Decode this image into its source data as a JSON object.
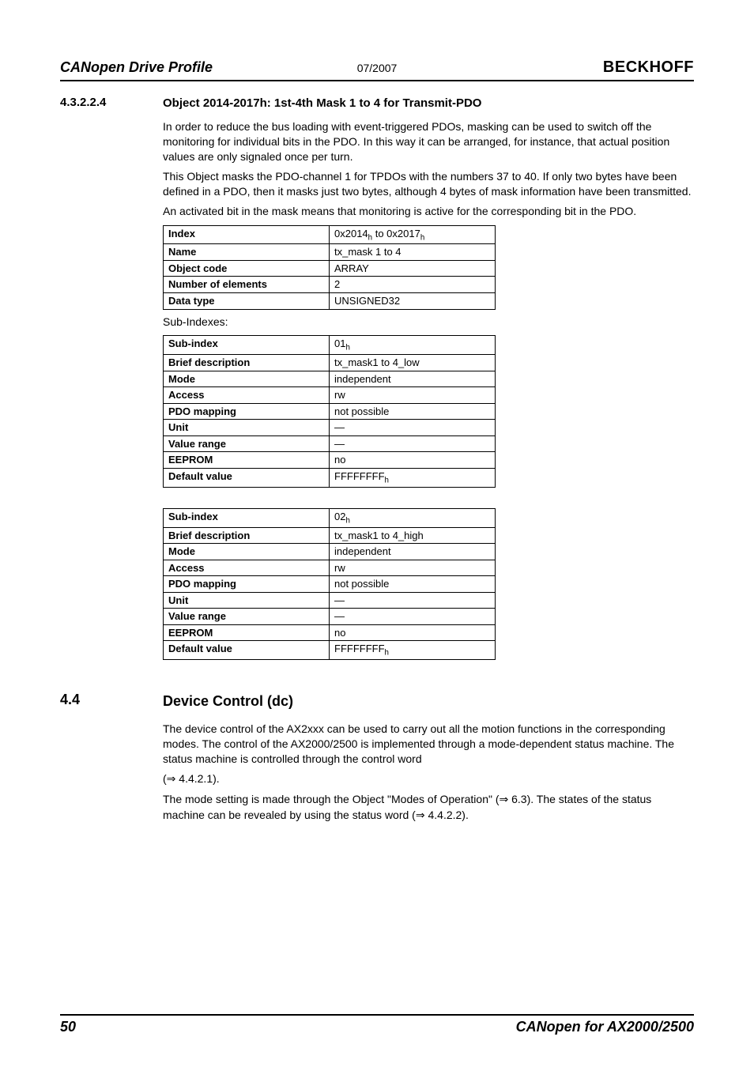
{
  "header": {
    "left": "CANopen Drive Profile",
    "center": "07/2007",
    "right": "BECKHOFF"
  },
  "sec1": {
    "number": "4.3.2.2.4",
    "title": "Object 2014-2017h: 1st-4th Mask 1 to 4 for Transmit-PDO",
    "p1": "In order to reduce the bus loading with event-triggered PDOs, masking can be used to switch off the monitoring for individual bits in the PDO. In this way it can be arranged, for instance, that actual position values are only signaled once per turn.",
    "p2": "This Object masks  the PDO-channel 1 for TPDOs with the numbers 37 to 40. If only two bytes have been defined in a PDO, then it masks just two bytes, although 4 bytes of mask information have been transmitted.",
    "p3": "An activated bit in the mask means that monitoring is active for the corresponding bit in the PDO.",
    "t1": {
      "index_l": "Index",
      "index_v_a": "0x2014",
      "index_v_b": " to 0x2017",
      "name_l": "Name",
      "name_v": "tx_mask 1 to 4",
      "oc_l": "Object code",
      "oc_v": "ARRAY",
      "ne_l": "Number of elements",
      "ne_v": "2",
      "dt_l": "Data type",
      "dt_v": "UNSIGNED32"
    },
    "subidx_label": "Sub-Indexes:",
    "t2": {
      "si_l": "Sub-index",
      "si_v": "01",
      "bd_l": "Brief description",
      "bd_v": "tx_mask1 to 4_low",
      "md_l": "Mode",
      "md_v": "independent",
      "ac_l": "Access",
      "ac_v": "rw",
      "pm_l": "PDO mapping",
      "pm_v": "not possible",
      "un_l": "Unit",
      "un_v": "—",
      "vr_l": "Value range",
      "vr_v": "—",
      "ee_l": "EEPROM",
      "ee_v": "no",
      "dv_l": "Default value",
      "dv_v": "FFFFFFFF"
    },
    "t3": {
      "si_l": "Sub-index",
      "si_v": "02",
      "bd_l": "Brief description",
      "bd_v": "tx_mask1 to 4_high",
      "md_l": "Mode",
      "md_v": "independent",
      "ac_l": "Access",
      "ac_v": "rw",
      "pm_l": "PDO mapping",
      "pm_v": "not possible",
      "un_l": "Unit",
      "un_v": "—",
      "vr_l": "Value range",
      "vr_v": "—",
      "ee_l": "EEPROM",
      "ee_v": "no",
      "dv_l": "Default value",
      "dv_v": "FFFFFFFF"
    }
  },
  "sec2": {
    "number": "4.4",
    "title": "Device Control (dc)",
    "p1": "The device control of the AX2xxx can be used to carry out all the motion functions in the corresponding modes. The control of the AX2000/2500 is implemented through a mode-dependent status machine. The status machine is controlled through the control word",
    "p2a": "(",
    "p2b": " 4.4.2.1).",
    "p3a": "The mode setting is made through the Object \"Modes of Operation\" (",
    "p3b": " 6.3). The states of the status machine can be revealed by using the status word (",
    "p3c": " 4.4.2.2)."
  },
  "footer": {
    "page": "50",
    "right": "CANopen for AX2000/2500"
  }
}
